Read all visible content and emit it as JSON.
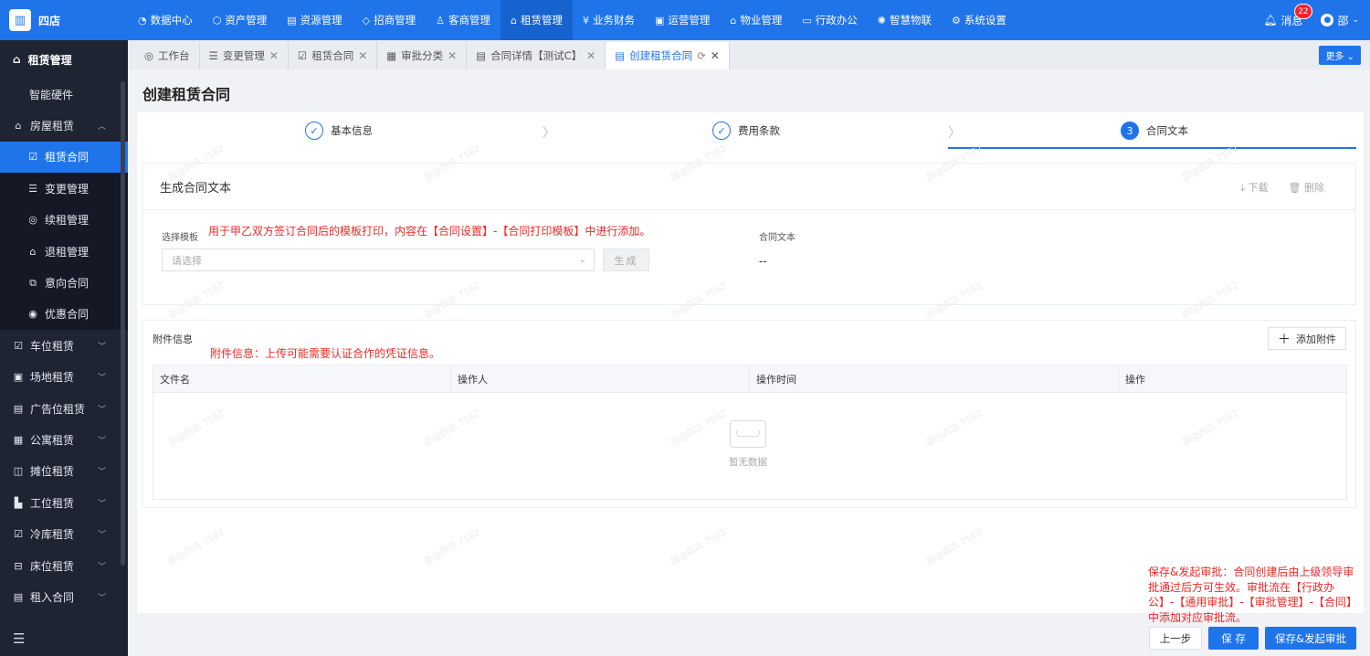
{
  "app": {
    "logo_icon": "building-icon",
    "name": "四店"
  },
  "topnav": [
    {
      "icon": "◔",
      "label": "数据中心"
    },
    {
      "icon": "⬡",
      "label": "资产管理"
    },
    {
      "icon": "▤",
      "label": "资源管理"
    },
    {
      "icon": "◇",
      "label": "招商管理"
    },
    {
      "icon": "♙",
      "label": "客商管理"
    },
    {
      "icon": "⌂",
      "label": "租赁管理",
      "active": true
    },
    {
      "icon": "¥",
      "label": "业务财务"
    },
    {
      "icon": "▣",
      "label": "运营管理"
    },
    {
      "icon": "⌂",
      "label": "物业管理"
    },
    {
      "icon": "▭",
      "label": "行政办公"
    },
    {
      "icon": "✺",
      "label": "智慧物联"
    },
    {
      "icon": "⚙",
      "label": "系统设置"
    }
  ],
  "header_right": {
    "messages_label": "消息",
    "messages_badge": "22",
    "user_name": "邵"
  },
  "sidebar": {
    "title": "租赁管理",
    "items": [
      {
        "label": "智能硬件",
        "type": "plain"
      },
      {
        "label": "房屋租赁",
        "icon": "⌂",
        "expanded": true
      },
      {
        "label": "租赁合同",
        "icon": "☑",
        "type": "sub",
        "active": true
      },
      {
        "label": "变更管理",
        "icon": "☰",
        "type": "sub"
      },
      {
        "label": "续租管理",
        "icon": "◎",
        "type": "sub"
      },
      {
        "label": "退租管理",
        "icon": "⌂",
        "type": "sub"
      },
      {
        "label": "意向合同",
        "icon": "⧉",
        "type": "sub"
      },
      {
        "label": "优惠合同",
        "icon": "◉",
        "type": "sub"
      },
      {
        "label": "车位租赁",
        "icon": "☑"
      },
      {
        "label": "场地租赁",
        "icon": "▣"
      },
      {
        "label": "广告位租赁",
        "icon": "▤"
      },
      {
        "label": "公寓租赁",
        "icon": "▦"
      },
      {
        "label": "摊位租赁",
        "icon": "◫"
      },
      {
        "label": "工位租赁",
        "icon": "▙"
      },
      {
        "label": "冷库租赁",
        "icon": "☑"
      },
      {
        "label": "床位租赁",
        "icon": "⊟"
      },
      {
        "label": "租入合同",
        "icon": "▤"
      }
    ]
  },
  "tabs": [
    {
      "icon": "◎",
      "label": "工作台"
    },
    {
      "icon": "☰",
      "label": "变更管理"
    },
    {
      "icon": "☑",
      "label": "租赁合同"
    },
    {
      "icon": "▦",
      "label": "审批分类"
    },
    {
      "icon": "▤",
      "label": "合同详情【测试C】"
    },
    {
      "icon": "▤",
      "label": "创建租赁合同",
      "active": true
    }
  ],
  "more_label": "更多 ⌄",
  "page_title": "创建租赁合同",
  "steps": [
    {
      "label": "基本信息",
      "state": "done"
    },
    {
      "label": "费用条款",
      "state": "done"
    },
    {
      "label": "合同文本",
      "state": "current",
      "number": "3"
    }
  ],
  "gen_section": {
    "title": "生成合同文本",
    "download_label": "下载",
    "delete_label": "删除",
    "template_label": "选择模板",
    "template_note": "用于甲乙双方签订合同后的模板打印，内容在【合同设置】-【合同打印模板】中进行添加。",
    "select_placeholder": "请选择",
    "generate_label": "生成",
    "contract_text_label": "合同文本",
    "contract_text_value": "--"
  },
  "attachment_section": {
    "title": "附件信息",
    "note": "附件信息：上传可能需要认证合作的凭证信息。",
    "add_label": "添加附件",
    "columns": [
      "文件名",
      "操作人",
      "操作时间",
      "操作"
    ],
    "empty_text": "暂无数据"
  },
  "footer": {
    "note": "保存&发起审批：合同创建后由上级领导审批通过后方可生效。审批流在【行政办公】-【通用审批】-【审批管理】-【合同】中添加对应审批流。",
    "prev_label": "上一步",
    "save_label": "保 存",
    "submit_label": "保存&发起审批"
  },
  "watermark": "邵@四店 7562"
}
